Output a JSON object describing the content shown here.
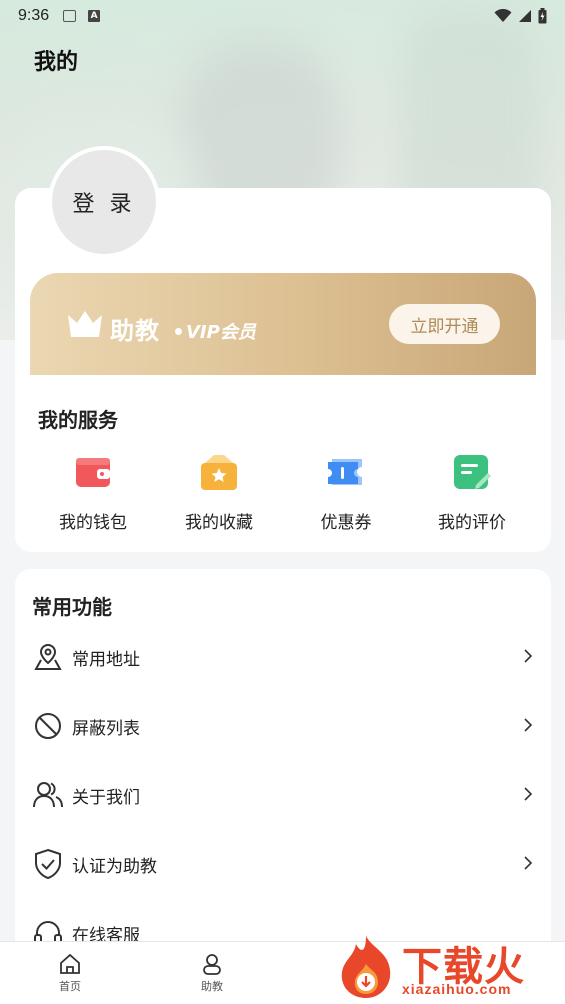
{
  "status_bar": {
    "time": "9:36",
    "notif_glyph": "A"
  },
  "header": {
    "title": "我的"
  },
  "profile": {
    "login_label": "登 录"
  },
  "vip": {
    "brand": "助教",
    "member": "VIP会员",
    "button": "立即开通"
  },
  "services": {
    "title": "我的服务",
    "items": [
      {
        "label": "我的钱包",
        "icon": "wallet-icon",
        "color": "#f0585b"
      },
      {
        "label": "我的收藏",
        "icon": "collection-icon",
        "color": "#f7b23b"
      },
      {
        "label": "优惠券",
        "icon": "coupon-icon",
        "color": "#3f8df2"
      },
      {
        "label": "我的评价",
        "icon": "review-icon",
        "color": "#3cc17e"
      }
    ]
  },
  "functions": {
    "title": "常用功能",
    "items": [
      {
        "label": "常用地址",
        "icon": "location-icon"
      },
      {
        "label": "屏蔽列表",
        "icon": "block-icon"
      },
      {
        "label": "关于我们",
        "icon": "users-icon"
      },
      {
        "label": "认证为助教",
        "icon": "shield-check-icon"
      },
      {
        "label": "在线客服",
        "icon": "headset-icon"
      }
    ]
  },
  "bottom_nav": {
    "items": [
      {
        "label": "首页",
        "icon": "home-icon"
      },
      {
        "label": "助教",
        "icon": "assistant-icon"
      }
    ]
  },
  "watermark": {
    "text": "下载火",
    "url": "xiazaihuo.com"
  }
}
